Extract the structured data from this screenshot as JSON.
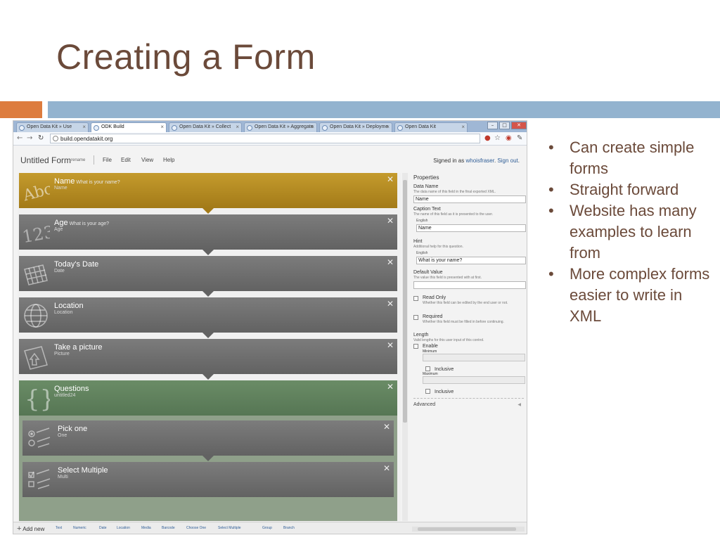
{
  "slide": {
    "title": "Creating a Form",
    "bullets": [
      "Can create simple forms",
      "Straight forward",
      "Website has many examples to learn from",
      "More complex forms easier to write in XML"
    ]
  },
  "browser": {
    "tabs": [
      {
        "label": "Open Data Kit » Use"
      },
      {
        "label": "ODK Build"
      },
      {
        "label": "Open Data Kit » Collect"
      },
      {
        "label": "Open Data Kit » Aggregate"
      },
      {
        "label": "Open Data Kit » Deployme"
      },
      {
        "label": "Open Data Kit"
      }
    ],
    "url": "build.opendatakit.org"
  },
  "app": {
    "form_title": "Untitled Form",
    "rename": "rename",
    "menu": [
      "File",
      "Edit",
      "View",
      "Help"
    ],
    "signed_in_prefix": "Signed in as",
    "username": "whoisfraser",
    "sign_out": "Sign out",
    "controls": [
      {
        "name": "Name",
        "hint": "What is your name?",
        "sub": "Name",
        "color": "#b38a22",
        "icon": "abc-icon"
      },
      {
        "name": "Age",
        "hint": "What is your age?",
        "sub": "Age",
        "color": "#6e6e6e",
        "icon": "numeric-icon"
      },
      {
        "name": "Today's Date",
        "hint": "",
        "sub": "Date",
        "color": "#6e6e6e",
        "icon": "calendar-icon"
      },
      {
        "name": "Location",
        "hint": "",
        "sub": "Location",
        "color": "#6e6e6e",
        "icon": "globe-icon"
      },
      {
        "name": "Take a picture",
        "hint": "",
        "sub": "Picture",
        "color": "#6e6e6e",
        "icon": "picture-icon"
      },
      {
        "name": "Questions",
        "hint": "",
        "sub": "untitled24",
        "color": "#5f815c",
        "icon": "braces-icon"
      }
    ],
    "group_controls": [
      {
        "name": "Pick one",
        "sub": "One",
        "icon": "pick-one-icon"
      },
      {
        "name": "Select Multiple",
        "sub": "Multi",
        "icon": "select-multiple-icon"
      }
    ],
    "properties": {
      "title": "Properties",
      "data_name": {
        "label": "Data Name",
        "desc": "The data name of this field in the final exported XML.",
        "value": "Name"
      },
      "caption": {
        "label": "Caption Text",
        "desc": "The name of this field as it is presented to the user.",
        "lang": "English",
        "value": "Name"
      },
      "hint": {
        "label": "Hint",
        "desc": "Additional help for this question.",
        "lang": "English",
        "value": "What is your name?"
      },
      "default": {
        "label": "Default Value",
        "desc": "The value this field is presented with at first.",
        "value": ""
      },
      "read_only": {
        "label": "Read Only",
        "desc": "Whether this field can be edited by the end user or not."
      },
      "required": {
        "label": "Required",
        "desc": "Whether this field must be filled in before continuing."
      },
      "length": {
        "label": "Length",
        "desc": "Valid lengths for this user input of this control.",
        "enable": "Enable",
        "minimum": "Minimum",
        "inclusive": "Inclusive",
        "maximum": "Maximum"
      },
      "advanced": "Advanced"
    },
    "add_new": "Add new",
    "add_types": [
      "Text",
      "Numeric",
      "Date",
      "Location",
      "Media",
      "Barcode",
      "Choose One",
      "Select Multiple",
      "Group",
      "Branch"
    ]
  }
}
